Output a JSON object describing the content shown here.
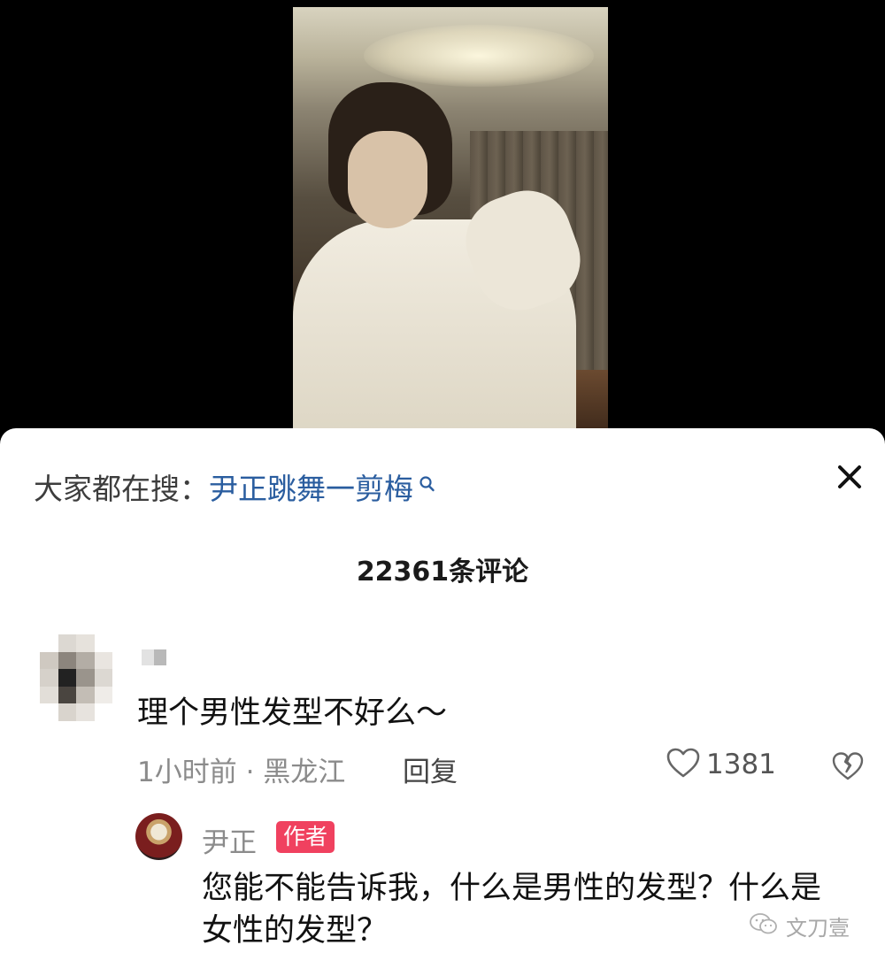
{
  "video": {
    "description_icon": "video-frame"
  },
  "search": {
    "prefix": "大家都在搜：",
    "query": "尹正跳舞一剪梅",
    "icon": "search-icon"
  },
  "close_icon": "close-icon",
  "comments_header": {
    "count_label": "22361条评论"
  },
  "comment": {
    "text": "理个男性发型不好么～",
    "time_location": "1小时前 · 黑龙江",
    "reply_label": "回复",
    "like_count": "1381",
    "like_icon": "heart-icon",
    "dislike_icon": "broken-heart-icon"
  },
  "author_reply": {
    "username": "尹正",
    "badge": "作者",
    "text": "您能不能告诉我，什么是男性的发型？什么是女性的发型？"
  },
  "watermark": {
    "text": "文刀壹",
    "icon": "wechat-icon"
  },
  "colors": {
    "link_blue": "#2a5d9f",
    "badge_red": "#f0415f",
    "meta_gray": "#8b8b8b"
  }
}
